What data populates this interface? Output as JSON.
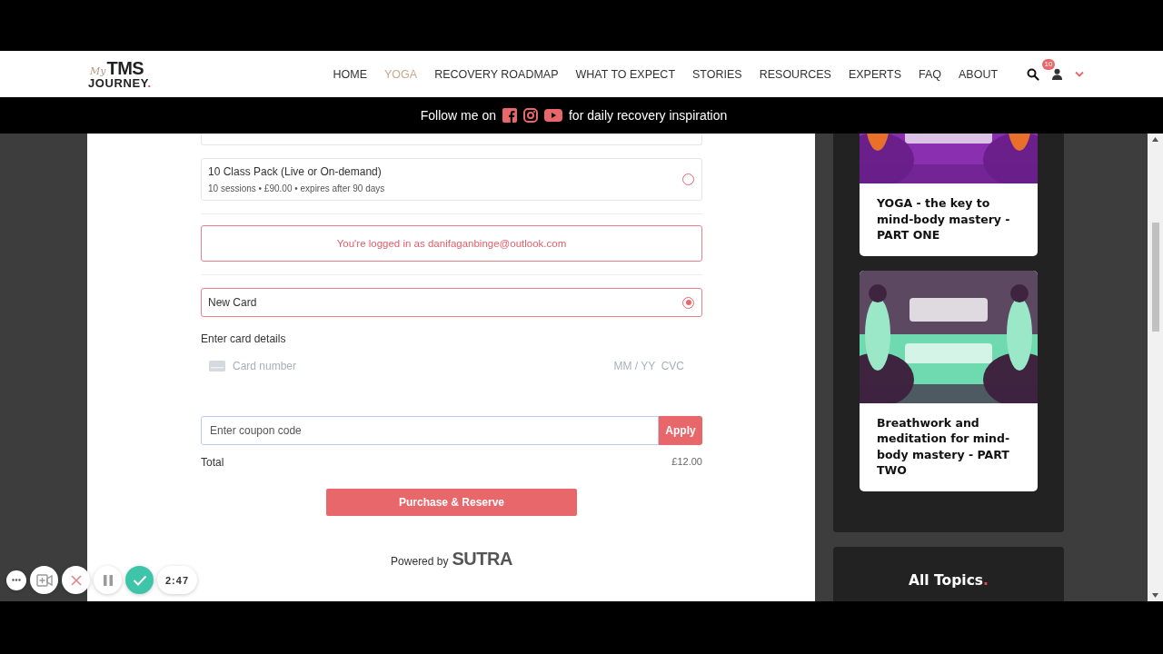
{
  "logo": {
    "prefix": "My",
    "name": "TMS",
    "line2": "JOURNEY",
    "dot": "."
  },
  "nav": [
    {
      "label": "HOME",
      "selected": false
    },
    {
      "label": "YOGA",
      "selected": true
    },
    {
      "label": "RECOVERY ROADMAP",
      "selected": false
    },
    {
      "label": "WHAT TO EXPECT",
      "selected": false
    },
    {
      "label": "STORIES",
      "selected": false
    },
    {
      "label": "RESOURCES",
      "selected": false
    },
    {
      "label": "EXPERTS",
      "selected": false
    },
    {
      "label": "FAQ",
      "selected": false
    },
    {
      "label": "ABOUT",
      "selected": false
    }
  ],
  "cart_badge": "10",
  "banner": {
    "before": "Follow me on",
    "after": "for daily recovery inspiration"
  },
  "packs": [
    {
      "title": "10 Class Pack (Live or On-demand)",
      "details": "10 sessions • £90.00 • expires after 90 days",
      "selected": false
    }
  ],
  "login_notice": "You're logged in as danifaganbinge@outlook.com",
  "payment_options": [
    {
      "label": "New Card",
      "selected": true
    }
  ],
  "card_details": {
    "label": "Enter card details",
    "number_placeholder": "Card number",
    "expiry_placeholder": "MM / YY  CVC"
  },
  "coupon": {
    "placeholder": "Enter coupon code",
    "button": "Apply"
  },
  "total": {
    "label": "Total",
    "value": "£12.00"
  },
  "purchase_button": "Purchase & Reserve",
  "powered_by": {
    "text": "Powered by",
    "brand": "SUTRA"
  },
  "sidebar_posts": [
    {
      "title": "YOGA - the key to mind-body mastery - PART ONE",
      "kind": "picture"
    },
    {
      "title": "Breathwork and meditation for mind-body mastery - PART TWO",
      "kind": "picture"
    }
  ],
  "topics": {
    "title": "All Topics",
    "dot": "."
  },
  "recorder": {
    "timer": "2:47"
  }
}
